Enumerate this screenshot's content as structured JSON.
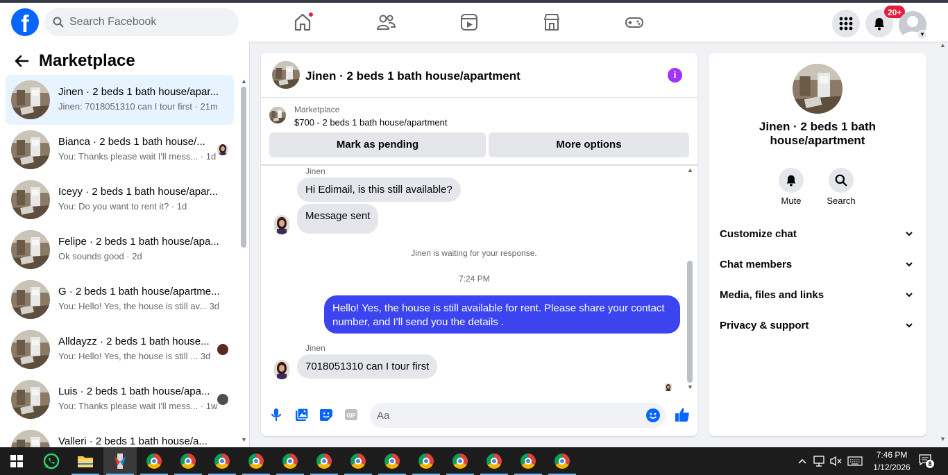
{
  "topbar": {
    "search_placeholder": "Search Facebook",
    "notifications_badge": "20+"
  },
  "sidebar": {
    "title": "Marketplace",
    "conversations": [
      {
        "name": "Jinen · 2 beds 1 bath house/apar...",
        "preview": "Jinen: 7018051310 can I tour first · 21m",
        "active": true
      },
      {
        "name": "Bianca · 2 beds 1 bath house/...",
        "preview": "You: Thanks please wait I'll mess... · 1d"
      },
      {
        "name": "Iceyy · 2 beds 1 bath house/apar...",
        "preview": "You: Do you want to rent it? · 1d"
      },
      {
        "name": "Felipe · 2 beds 1 bath house/apa...",
        "preview": "Ok sounds good · 2d"
      },
      {
        "name": "G · 2 beds 1 bath house/apartme...",
        "preview": "You: Hello! Yes, the house is still av...  3d"
      },
      {
        "name": "Alldayzz · 2 beds 1 bath house...",
        "preview": "You: Hello! Yes, the house is still ...  3d"
      },
      {
        "name": "Luis · 2 beds 1 bath house/apa...",
        "preview": "You: Thanks please wait I'll mess... · 1w"
      },
      {
        "name": "Valleri · 2 beds 1 bath house/a...",
        "preview": ""
      }
    ]
  },
  "chat": {
    "title": "Jinen · 2 beds 1 bath house/apartment",
    "marketplace_label": "Marketplace",
    "listing": "$700 - 2 beds 1 bath house/apartment",
    "mark_pending": "Mark as pending",
    "more_options": "More options",
    "sender1": "Jinen",
    "msg1": "Hi Edimail, is this still available?",
    "msg2": "Message sent",
    "waiting_notice": "Jinen is waiting for your response.",
    "timestamp": "7:24 PM",
    "msg_out": "Hello! Yes, the house is still available for rent. Please share your contact number, and I'll send you the details .",
    "sender2": "Jinen",
    "msg3": "7018051310 can I tour first",
    "composer_placeholder": "Aa"
  },
  "details": {
    "title": "Jinen · 2 beds 1 bath house/apartment",
    "mute_label": "Mute",
    "search_label": "Search",
    "sections": [
      "Customize chat",
      "Chat members",
      "Media, files and links",
      "Privacy & support"
    ]
  },
  "taskbar": {
    "time": "7:46 PM",
    "date": "1/12/2026",
    "notification_count": "8"
  },
  "colors": {
    "brand": "#0866ff",
    "outgoing_bubble": "#3c44f0",
    "info_button": "#a033ff"
  }
}
